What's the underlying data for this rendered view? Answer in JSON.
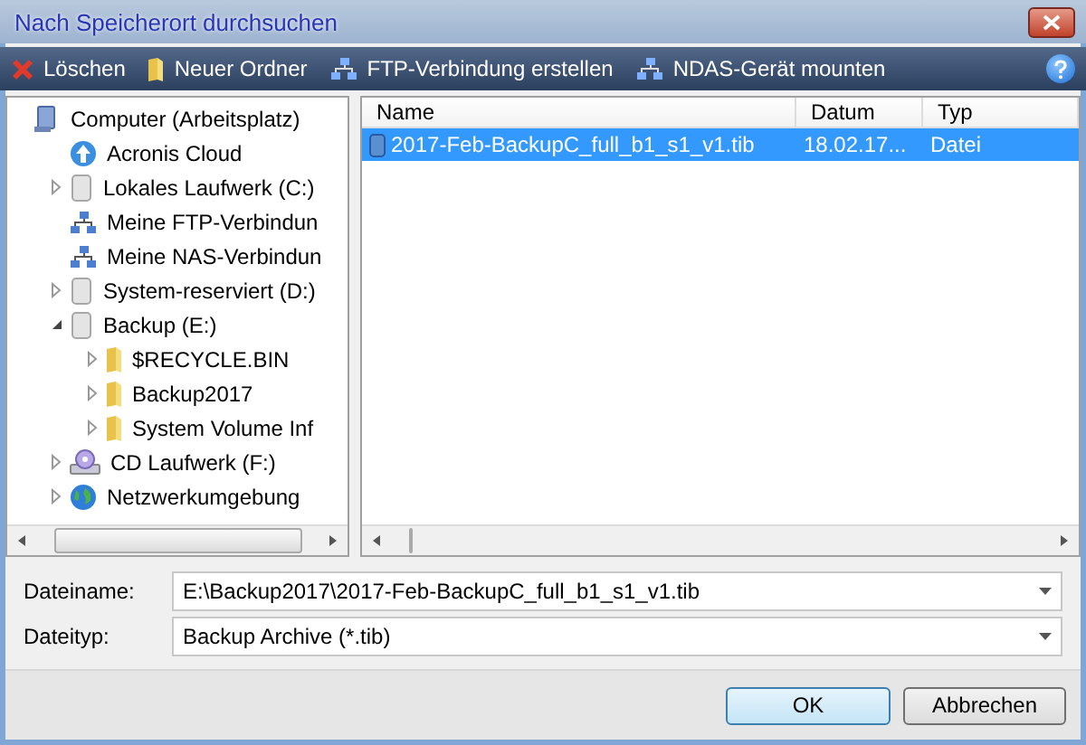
{
  "window": {
    "title": "Nach Speicherort durchsuchen"
  },
  "toolbar": [
    {
      "kind": "delete",
      "label": "Löschen"
    },
    {
      "kind": "folder",
      "label": "Neuer Ordner"
    },
    {
      "kind": "network",
      "label": "FTP-Verbindung erstellen"
    },
    {
      "kind": "network",
      "label": "NDAS-Gerät mounten"
    }
  ],
  "tree": [
    {
      "label": "Computer (Arbeitsplatz)",
      "kind": "computer",
      "children": [
        {
          "label": "Acronis Cloud",
          "kind": "cloud"
        },
        {
          "label": "Lokales Laufwerk (C:)",
          "kind": "drive",
          "expanded": false
        },
        {
          "label": "Meine FTP-Verbindun",
          "kind": "connection"
        },
        {
          "label": "Meine NAS-Verbindun",
          "kind": "connection"
        },
        {
          "label": "System-reserviert (D:)",
          "kind": "drive",
          "expanded": false
        },
        {
          "label": "Backup (E:)",
          "kind": "drive",
          "expanded": true,
          "children": [
            {
              "label": "$RECYCLE.BIN",
              "kind": "folder",
              "expanded": false
            },
            {
              "label": "Backup2017",
              "kind": "folder",
              "expanded": false
            },
            {
              "label": "System Volume Inf",
              "kind": "folder",
              "expanded": false
            }
          ]
        },
        {
          "label": "CD Laufwerk (F:)",
          "kind": "cd",
          "expanded": false
        },
        {
          "label": "Netzwerkumgebung",
          "kind": "globe",
          "expanded": false
        }
      ]
    }
  ],
  "file_list": {
    "columns": [
      "Name",
      "Datum",
      "Typ"
    ],
    "rows": [
      {
        "name": "2017-Feb-BackupC_full_b1_s1_v1.tib",
        "date": "18.02.17...",
        "type": "Datei",
        "selected": true
      }
    ]
  },
  "fields": [
    {
      "label": "Dateiname:",
      "value": "E:\\Backup2017\\2017-Feb-BackupC_full_b1_s1_v1.tib"
    },
    {
      "label": "Dateityp:",
      "value": "Backup Archive (*.tib)"
    }
  ],
  "buttons": [
    {
      "label": "OK",
      "default": true
    },
    {
      "label": "Abbrechen",
      "default": false
    }
  ]
}
